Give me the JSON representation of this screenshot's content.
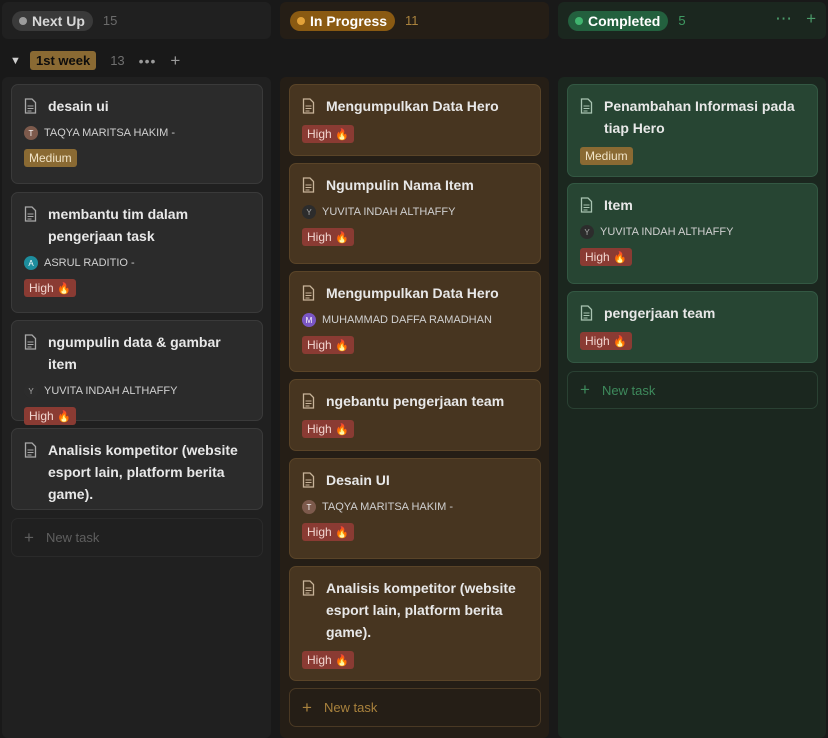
{
  "columns": {
    "next": {
      "label": "Next Up",
      "count": "15"
    },
    "progress": {
      "label": "In Progress",
      "count": "11"
    },
    "done": {
      "label": "Completed",
      "count": "5"
    }
  },
  "group": {
    "label": "1st week",
    "count": "13"
  },
  "new_task_label": "New task",
  "priority": {
    "high": "High",
    "medium": "Medium",
    "high_emoji": "🔥"
  },
  "people": {
    "taqya": {
      "initial": "T",
      "name": "TAQYA MARITSA HAKIM -"
    },
    "asrul": {
      "initial": "A",
      "name": "ASRUL RADITIO -"
    },
    "yuvita": {
      "initial": "Y",
      "name": "YUVITA INDAH ALTHAFFY"
    },
    "daffa": {
      "initial": "M",
      "name": "MUHAMMAD DAFFA RAMADHAN"
    }
  },
  "next_cards": [
    {
      "title": "desain ui"
    },
    {
      "title": "membantu tim dalam pengerjaan task"
    },
    {
      "title": "ngumpulin data & gambar item"
    },
    {
      "title": "Analisis kompetitor (website esport lain, platform berita game)."
    }
  ],
  "progress_cards": [
    {
      "title": "Mengumpulkan Data Hero"
    },
    {
      "title": "Ngumpulin Nama Item"
    },
    {
      "title": "Mengumpulkan Data Hero"
    },
    {
      "title": "ngebantu pengerjaan team"
    },
    {
      "title": "Desain UI"
    },
    {
      "title": "Analisis kompetitor (website esport lain, platform berita game)."
    }
  ],
  "done_cards": [
    {
      "title": "Penambahan Informasi pada tiap Hero"
    },
    {
      "title": "Item"
    },
    {
      "title": "pengerjaan team"
    }
  ],
  "colors": {
    "next_accent": "#9b9b9b",
    "progress_accent": "#e3a239",
    "done_accent": "#40b46f",
    "high_badge": "#8a3b33",
    "medium_badge": "#8a6a33"
  }
}
